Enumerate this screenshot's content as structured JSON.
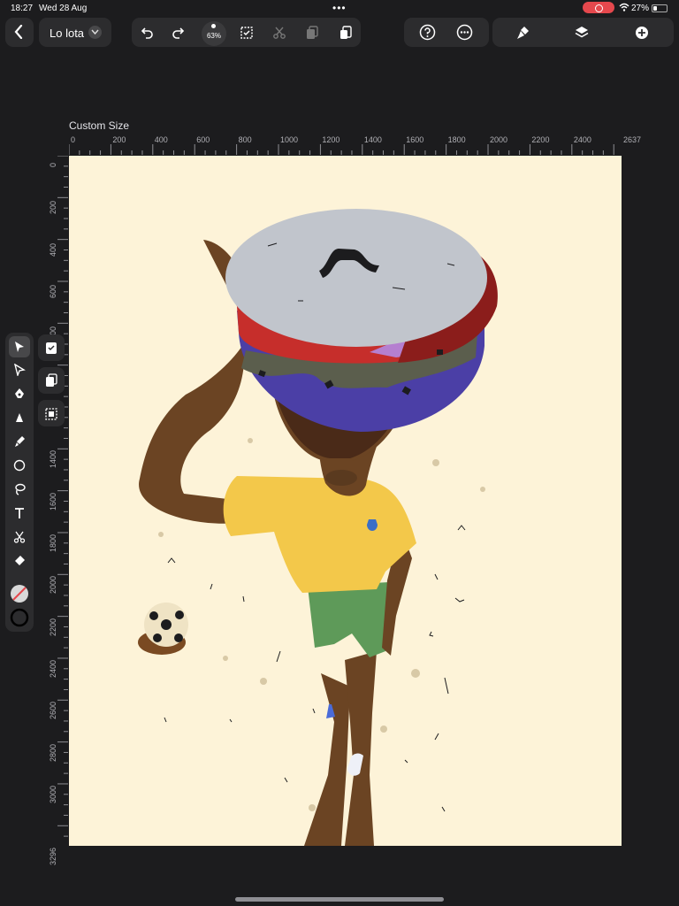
{
  "status_bar": {
    "time": "18:27",
    "date": "Wed 28 Aug",
    "battery": "27%"
  },
  "document": {
    "title": "Lo lota"
  },
  "toolbar": {
    "zoom": "63%"
  },
  "canvas": {
    "label": "Custom Size"
  },
  "ruler": {
    "h_ticks": [
      "0",
      "200",
      "400",
      "600",
      "800",
      "1000",
      "1200",
      "1400",
      "1600",
      "1800",
      "2000",
      "2200",
      "2400",
      "2637"
    ],
    "v_ticks": [
      "0",
      "200",
      "400",
      "600",
      "800",
      "1000",
      "1200",
      "1400",
      "1600",
      "1800",
      "2000",
      "2200",
      "2400",
      "2600",
      "2800",
      "3000",
      "3296"
    ]
  },
  "icons": {
    "top": [
      "back-icon",
      "undo-icon",
      "redo-icon",
      "select-icon",
      "cut-icon",
      "copy-icon",
      "paste-icon",
      "help-icon",
      "more-icon",
      "brush-icon",
      "layers-icon",
      "add-icon"
    ],
    "left": [
      "selection-icon",
      "direct-selection-icon",
      "pen-icon",
      "vector-brush-icon",
      "brush-icon",
      "shape-icon",
      "lasso-icon",
      "text-icon",
      "scissors-icon",
      "eraser-icon",
      "fill-none-icon",
      "stroke-icon"
    ]
  },
  "colors": {
    "background": "#1c1c1e",
    "panel": "#2c2c2e",
    "artboard": "#fdf3d8",
    "record": "#e5484d"
  }
}
